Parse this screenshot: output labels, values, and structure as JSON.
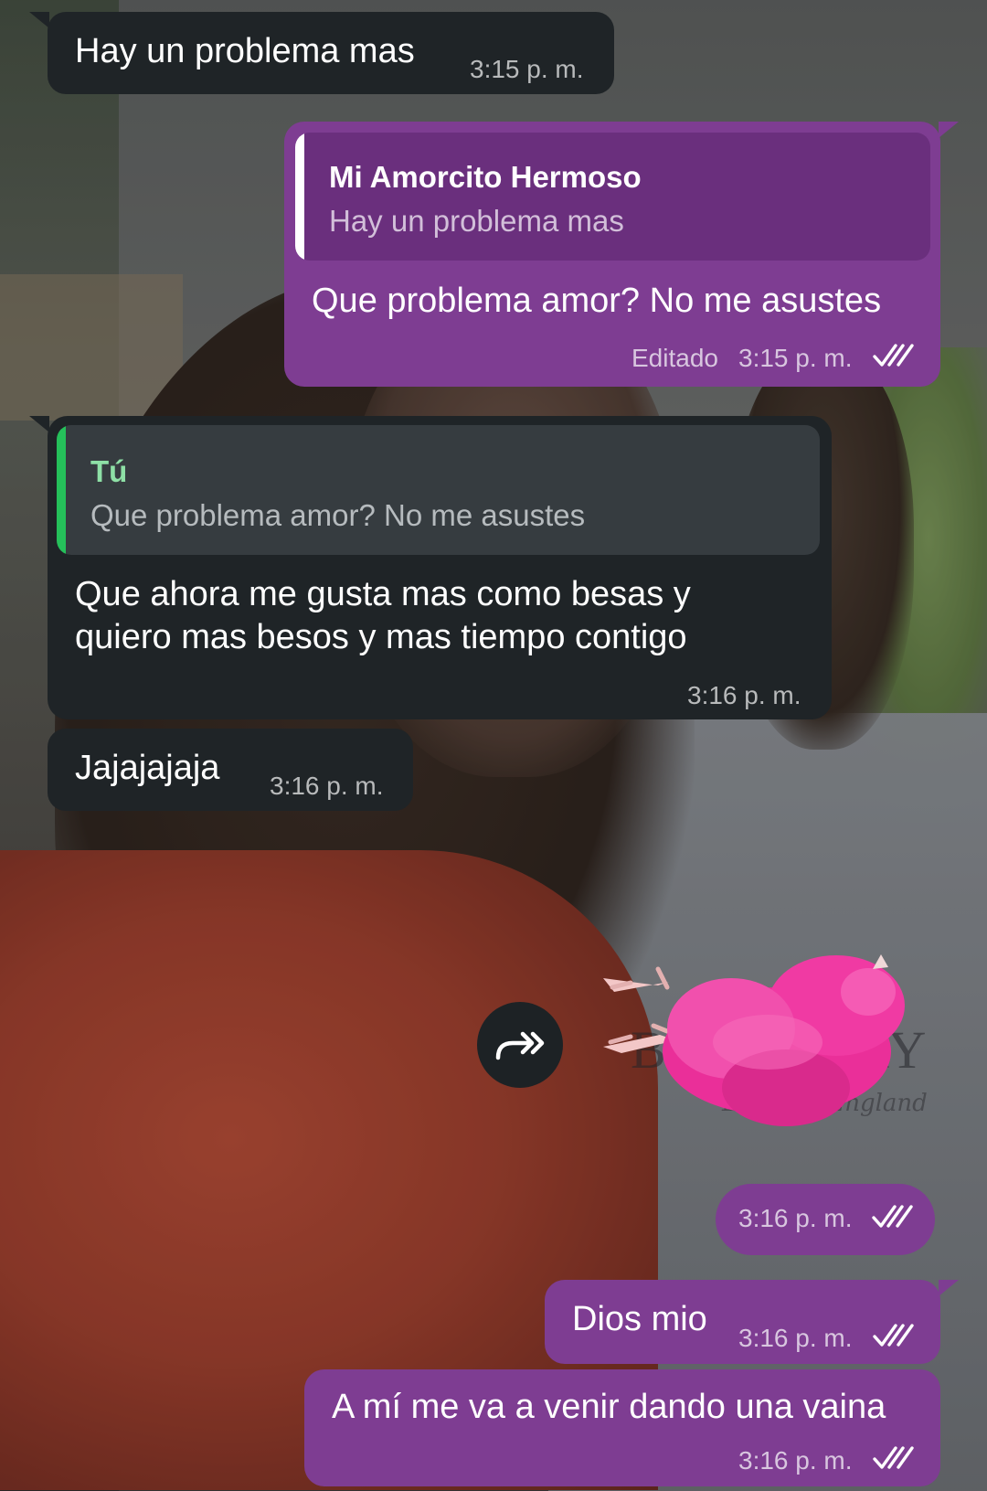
{
  "messages": [
    {
      "direction": "incoming",
      "text": "Hay un problema mas",
      "time": "3:15 p. m."
    },
    {
      "direction": "outgoing",
      "reply": {
        "name": "Mi Amorcito Hermoso",
        "text": "Hay un problema mas"
      },
      "text": "Que problema amor? No me asustes",
      "edited_label": "Editado",
      "time": "3:15 p. m.",
      "status": "read"
    },
    {
      "direction": "incoming",
      "reply": {
        "name": "Tú",
        "text": "Que problema amor? No me asustes"
      },
      "lines": [
        "Que ahora me gusta mas como besas y",
        "quiero mas besos y mas tiempo contigo"
      ],
      "time": "3:16 p. m."
    },
    {
      "direction": "incoming",
      "text": "Jajajajaja",
      "time": "3:16 p. m."
    },
    {
      "direction": "outgoing",
      "type": "sticker",
      "sticker": "pink-chick-sticker",
      "time": "3:16 p. m.",
      "status": "read"
    },
    {
      "direction": "outgoing",
      "text": "Dios mio",
      "time": "3:16 p. m.",
      "status": "read"
    },
    {
      "direction": "outgoing",
      "text": "A mí me va a venir dando una vaina",
      "time": "3:16 p. m.",
      "status": "read"
    }
  ],
  "wallpaper": {
    "brand": "BURBERRY",
    "sub": "London, England"
  },
  "icons": {
    "forward": "forward-icon",
    "read_status": "double-check-icon"
  },
  "colors": {
    "incoming_bubble": "#1f2427",
    "outgoing_bubble": "#7e3d92",
    "reply_bar_out": "#ffffff",
    "reply_bar_in": "#25c05a",
    "reply_name_in": "#8ee0a6"
  }
}
